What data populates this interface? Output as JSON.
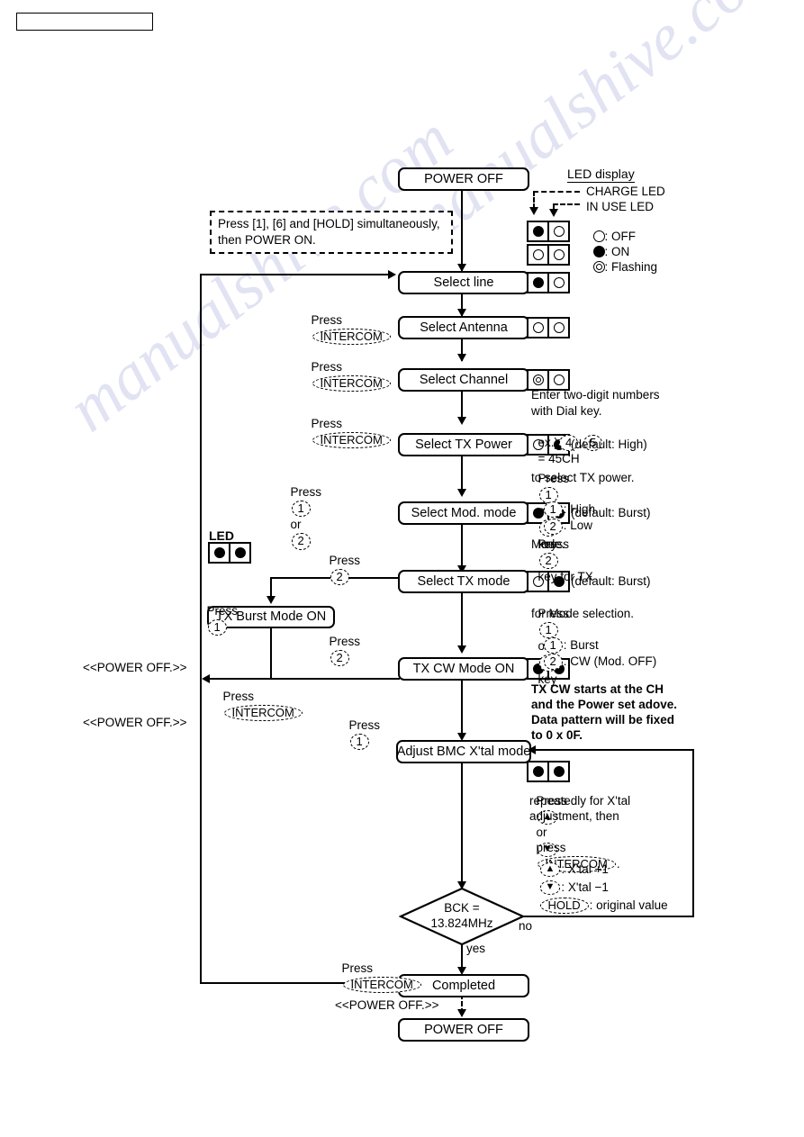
{
  "header": {
    "box_label": ""
  },
  "legend": {
    "title": "LED display",
    "charge_led": "CHARGE LED",
    "in_use_led": "IN USE LED",
    "off": ": OFF",
    "on": ": ON",
    "flashing": ": Flashing",
    "top_row": [
      "on",
      "off"
    ],
    "bottom_row": [
      "off",
      "off"
    ]
  },
  "start": {
    "label": "POWER OFF"
  },
  "entry_note": "Press [1], [6] and [HOLD] simultaneously,\nthen POWER ON.",
  "steps": [
    {
      "label": "Select line",
      "leds": [
        "on",
        "off"
      ]
    },
    {
      "label": "Select Antenna",
      "leds": [
        "off",
        "off"
      ]
    },
    {
      "label": "Select Channel",
      "leds": [
        "flash",
        "off"
      ]
    },
    {
      "label": "Select TX Power",
      "leds": [
        "off",
        "on"
      ]
    },
    {
      "label": "Select Mod. mode",
      "leds": [
        "on",
        "on"
      ]
    },
    {
      "label": "Select TX mode",
      "leds": [
        "off",
        "on"
      ]
    },
    {
      "label": "TX CW Mode ON",
      "leds": [
        "on",
        "on"
      ]
    },
    {
      "label": "Adjust BMC X'tal mode",
      "leds": [
        "on",
        "on"
      ]
    }
  ],
  "branch": {
    "label": "TX Burst Mode ON",
    "led_title": "LED",
    "leds": [
      "on",
      "on"
    ]
  },
  "transitions": {
    "t1": "Press",
    "t1_key": "INTERCOM",
    "t2": "Press",
    "t2_key": "INTERCOM",
    "t3": "Press",
    "t3_key": "INTERCOM",
    "t4_pre": "Press",
    "t4_k1": "1",
    "t4_mid": "or",
    "t4_k2": "2",
    "t5_pre": "Press",
    "t5_k1": "2",
    "t6_pre": "Press",
    "t6_k1": "1",
    "t7_pre": "Press",
    "t7_k1": "2",
    "t8_pre": "Press",
    "t8_key": "INTERCOM",
    "t9_pre": "Press",
    "t9_k1": "1",
    "t10_pre": "Press",
    "t10_key": "INTERCOM"
  },
  "notes": {
    "channel_l1": "Enter two-digit numbers",
    "channel_l2": "with Dial key.",
    "channel_ex_pre": "ex.)",
    "channel_ex_k1": "4",
    "channel_ex_comma": ",",
    "channel_ex_k2": "5",
    "channel_ex_post": "= 45CH",
    "power_default": "(default: High)",
    "power_l1_pre": "Press",
    "power_k1": "1",
    "power_l1_mid": "or",
    "power_k2": "2",
    "power_l1_post": "key",
    "power_l2": "to select TX power.",
    "power_l3_k1": "1",
    "power_l3_a": ": High,",
    "power_l3_k2": "2",
    "power_l3_b": ": Low",
    "mod_default": "(default: Burst)",
    "mod_l1_pre": "Press",
    "mod_k1": "2",
    "mod_l1_post": "key for TX",
    "mod_l2": "Mode.",
    "txmode_default": "(default: Burst)",
    "txmode_l1_pre": "Press",
    "txmode_k1": "1",
    "txmode_l1_mid": "or",
    "txmode_k2": "2",
    "txmode_l1_post": "key",
    "txmode_l2": "for Mode selection.",
    "txmode_l3_k": "1",
    "txmode_l3_t": ": Burst",
    "txmode_l4_k": "2",
    "txmode_l4_t": ": CW (Mod. OFF)",
    "cw_l1": "TX CW starts at the CH",
    "cw_l2": "and the Power set adove.",
    "cw_l3": "Data pattern will be fixed",
    "cw_l4": "to 0 x 0F.",
    "xtal_l1_pre": "Press",
    "xtal_k_up": "▲",
    "xtal_l1_mid": "or",
    "xtal_k_dn": "▼",
    "xtal_l2": "repeatedly for X'tal",
    "xtal_l3": "adjustment, then",
    "xtal_l4_pre": "press",
    "xtal_l4_key": "INTERCOM",
    "xtal_l4_post": ".",
    "xtal_up_t": ": X'tal +1",
    "xtal_dn_t": ": X'tal −1",
    "xtal_hold_key": "HOLD",
    "xtal_hold_t": ": original value"
  },
  "decision": {
    "line1": "BCK =",
    "line2": "13.824MHz",
    "yes": "yes",
    "no": "no"
  },
  "power_off_left_1": "<<POWER OFF.>>",
  "power_off_left_2": "<<POWER OFF.>>",
  "power_off_bottom": "<<POWER OFF.>>",
  "completed": {
    "label": "Completed"
  },
  "end": {
    "label": "POWER OFF"
  },
  "watermark": "manualshive.com"
}
